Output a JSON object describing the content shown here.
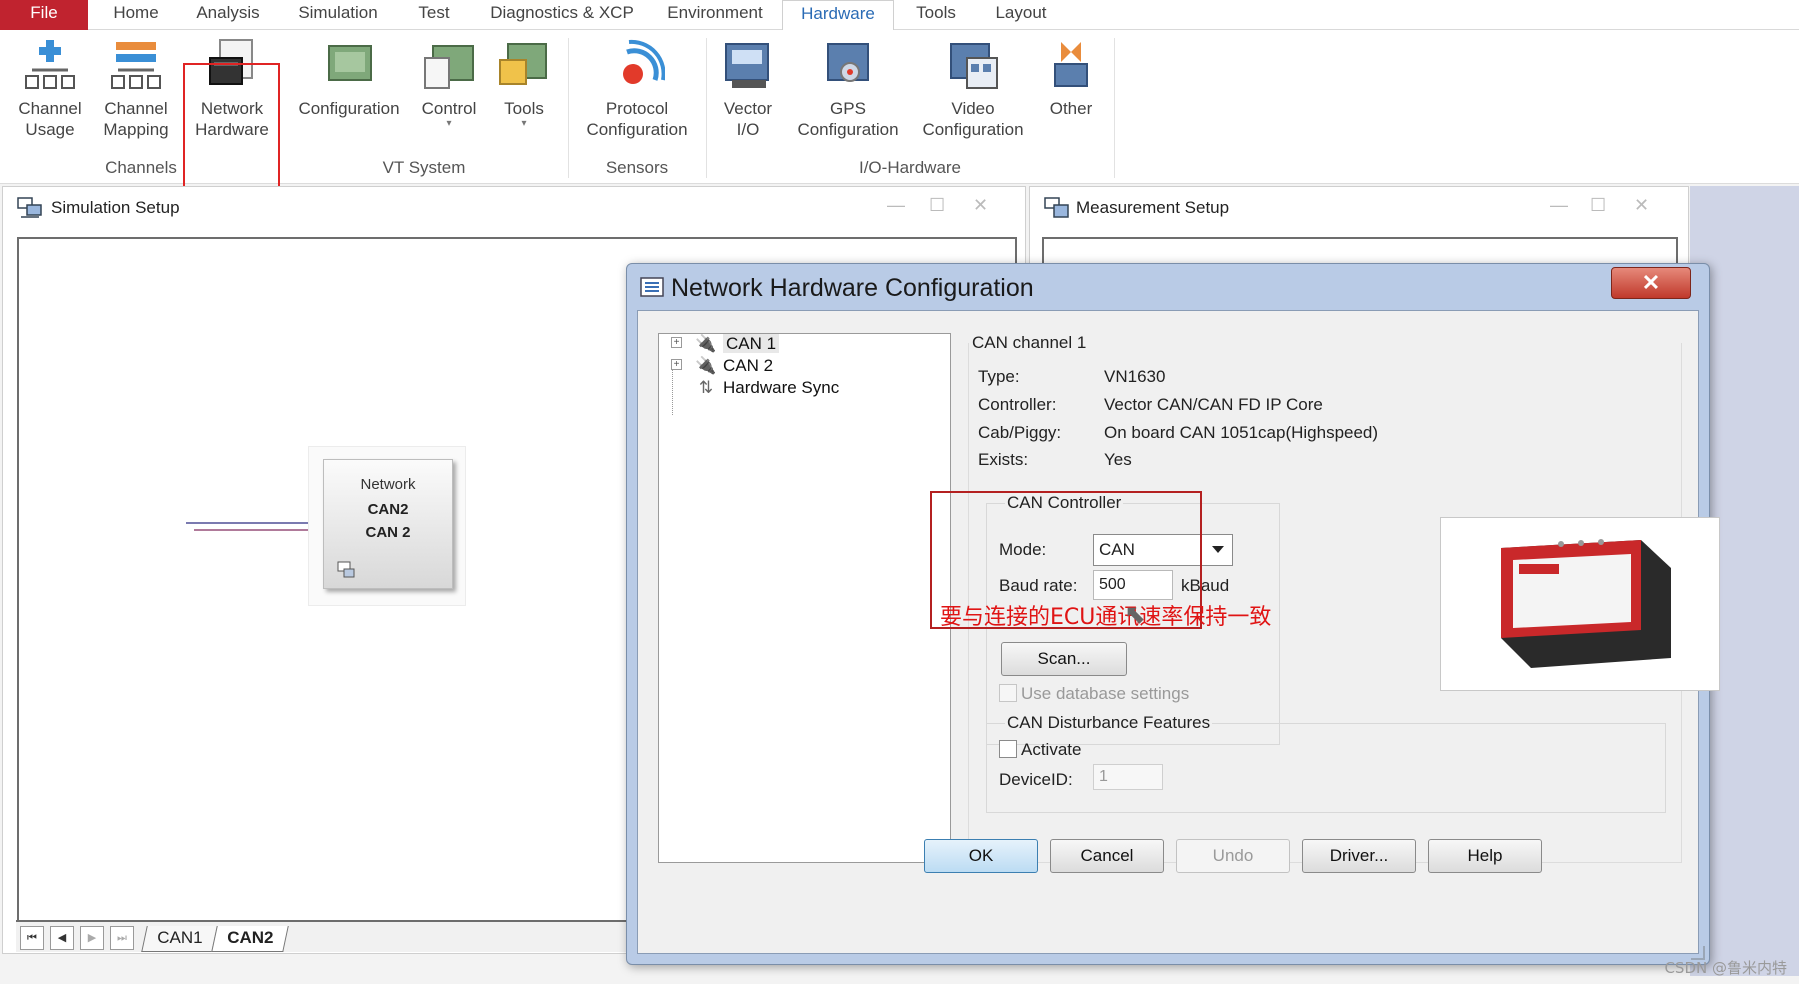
{
  "menu": {
    "items": [
      "File",
      "Home",
      "Analysis",
      "Simulation",
      "Test",
      "Diagnostics & XCP",
      "Environment",
      "Hardware",
      "Tools",
      "Layout"
    ],
    "active": "Hardware"
  },
  "ribbon": {
    "buttons": {
      "channel_usage": "Channel\nUsage",
      "channel_mapping": "Channel\nMapping",
      "network_hardware": "Network\nHardware",
      "configuration": "Configuration",
      "control": "Control",
      "tools": "Tools",
      "protocol_configuration": "Protocol\nConfiguration",
      "vector_io": "Vector\nI/O",
      "gps_configuration": "GPS\nConfiguration",
      "video_configuration": "Video\nConfiguration",
      "other": "Other"
    },
    "groups": {
      "channels": "Channels",
      "vt_system": "VT System",
      "sensors": "Sensors",
      "io_hardware": "I/O-Hardware"
    }
  },
  "simulation_setup": {
    "title": "Simulation Setup",
    "node": {
      "line1": "Network",
      "line2": "CAN2",
      "line3": "CAN 2"
    },
    "tabs": [
      "CAN1",
      "CAN2"
    ],
    "active_tab": "CAN2"
  },
  "measurement_setup": {
    "title": "Measurement Setup"
  },
  "dialog": {
    "title": "Network Hardware Configuration",
    "tree": [
      "CAN 1",
      "CAN 2",
      "Hardware Sync"
    ],
    "selected": "CAN 1",
    "section_title": "CAN channel 1",
    "props": {
      "type_label": "Type:",
      "type_value": "VN1630",
      "controller_label": "Controller:",
      "controller_value": "Vector CAN/CAN FD IP Core",
      "cab_label": "Cab/Piggy:",
      "cab_value": "On board CAN 1051cap(Highspeed)",
      "exists_label": "Exists:",
      "exists_value": "Yes"
    },
    "can_controller": {
      "title": "CAN Controller",
      "mode_label": "Mode:",
      "mode_value": "CAN",
      "baud_label": "Baud rate:",
      "baud_value": "500",
      "baud_unit": "kBaud",
      "scan_button": "Scan...",
      "use_db_label": "Use database settings"
    },
    "annotation": "要与连接的ECU通讯速率保持一致",
    "disturbance": {
      "title": "CAN Disturbance Features",
      "activate_label": "Activate",
      "device_label": "DeviceID:",
      "device_value": "1"
    },
    "buttons": {
      "ok": "OK",
      "cancel": "Cancel",
      "undo": "Undo",
      "driver": "Driver...",
      "help": "Help"
    },
    "close_glyph": "✕"
  },
  "watermark": "CSDN @鲁米内特",
  "colors": {
    "file_tab": "#c0232f",
    "active_tab": "#2a6bb5",
    "highlight": "#e02424",
    "annotation": "#e01414"
  }
}
